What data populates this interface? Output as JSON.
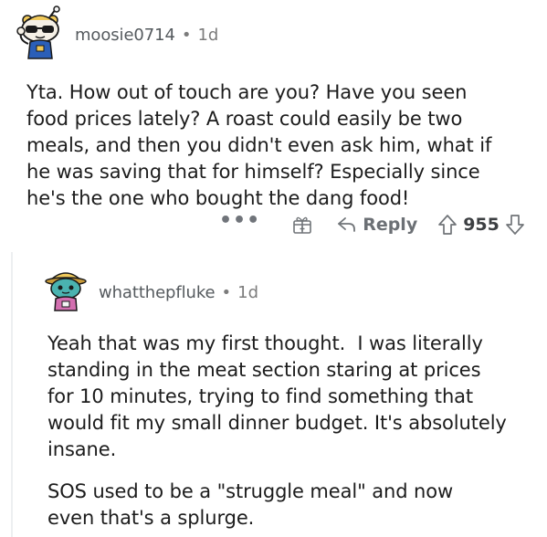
{
  "comments": [
    {
      "username": "moosie0714",
      "separator": "•",
      "age": "1d",
      "avatar_icon": "snoo-avatar-sunglasses-icon",
      "lines": [
        "Yta. How out of touch are you? Have you seen",
        "food prices lately? A roast could easily be two",
        "meals, and then you didn't even ask him, what if",
        "he was saving that for himself? Especially since",
        "he's the one who bought the dang food!"
      ],
      "actions": {
        "more_label": "•••",
        "award_icon": "gift-icon",
        "reply_icon": "reply-arrow-icon",
        "reply_label": "Reply",
        "upvote_icon": "upvote-arrow-icon",
        "score": "955",
        "downvote_icon": "downvote-arrow-icon"
      }
    },
    {
      "username": "whatthepfluke",
      "separator": "•",
      "age": "1d",
      "avatar_icon": "snoo-avatar-hat-icon",
      "paragraphs": [
        [
          "Yeah that was my first thought.  I was literally",
          "standing in the meat section staring at prices",
          "for 10 minutes, trying to find something that",
          "would fit my small dinner budget. It's absolutely",
          "insane."
        ],
        [
          "SOS used to be a \"struggle meal\" and now",
          "even that's a splurge."
        ]
      ]
    }
  ],
  "colors": {
    "text": "#1c1c1c",
    "meta": "#7c7c7c",
    "username": "#555a5e",
    "action": "#707478",
    "thread_line": "#edeff1"
  }
}
